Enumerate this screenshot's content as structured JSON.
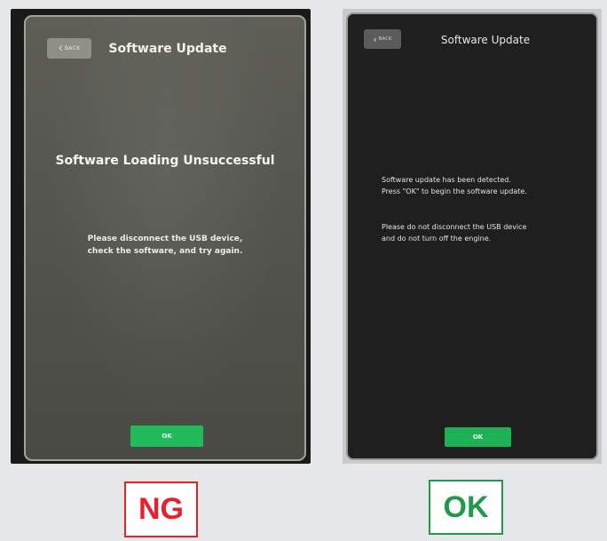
{
  "ng_panel": {
    "back_label": "BACK",
    "title": "Software Update",
    "heading": "Software Loading Unsuccessful",
    "body_line1": "Please disconnect the USB device,",
    "body_line2": "check the software, and try again.",
    "ok_label": "OK",
    "verdict": "NG",
    "verdict_color": "#e8202e"
  },
  "ok_panel": {
    "back_label": "BACK",
    "title": "Software Update",
    "message1_line1": "Software update has been detected.",
    "message1_line2": "Press \"OK\" to begin the software update.",
    "message2_line1": "Please do not disconnect the USB device",
    "message2_line2": "and do not turn off the engine.",
    "ok_label": "OK",
    "verdict": "OK",
    "verdict_color": "#1f9a4a"
  },
  "icons": {
    "back": "chevron-left-icon"
  },
  "colors": {
    "ok_button": "#22bb5b",
    "background": "#e6e7e9"
  }
}
